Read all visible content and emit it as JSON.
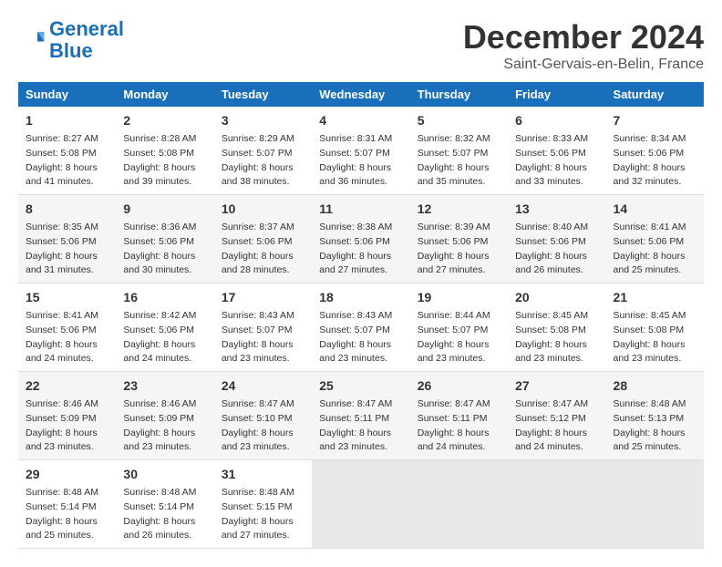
{
  "logo": {
    "line1": "General",
    "line2": "Blue"
  },
  "title": "December 2024",
  "location": "Saint-Gervais-en-Belin, France",
  "days_header": [
    "Sunday",
    "Monday",
    "Tuesday",
    "Wednesday",
    "Thursday",
    "Friday",
    "Saturday"
  ],
  "weeks": [
    [
      {
        "day": "1",
        "rise": "8:27 AM",
        "set": "5:08 PM",
        "daylight": "8 hours and 41 minutes."
      },
      {
        "day": "2",
        "rise": "8:28 AM",
        "set": "5:08 PM",
        "daylight": "8 hours and 39 minutes."
      },
      {
        "day": "3",
        "rise": "8:29 AM",
        "set": "5:07 PM",
        "daylight": "8 hours and 38 minutes."
      },
      {
        "day": "4",
        "rise": "8:31 AM",
        "set": "5:07 PM",
        "daylight": "8 hours and 36 minutes."
      },
      {
        "day": "5",
        "rise": "8:32 AM",
        "set": "5:07 PM",
        "daylight": "8 hours and 35 minutes."
      },
      {
        "day": "6",
        "rise": "8:33 AM",
        "set": "5:06 PM",
        "daylight": "8 hours and 33 minutes."
      },
      {
        "day": "7",
        "rise": "8:34 AM",
        "set": "5:06 PM",
        "daylight": "8 hours and 32 minutes."
      }
    ],
    [
      {
        "day": "8",
        "rise": "8:35 AM",
        "set": "5:06 PM",
        "daylight": "8 hours and 31 minutes."
      },
      {
        "day": "9",
        "rise": "8:36 AM",
        "set": "5:06 PM",
        "daylight": "8 hours and 30 minutes."
      },
      {
        "day": "10",
        "rise": "8:37 AM",
        "set": "5:06 PM",
        "daylight": "8 hours and 28 minutes."
      },
      {
        "day": "11",
        "rise": "8:38 AM",
        "set": "5:06 PM",
        "daylight": "8 hours and 27 minutes."
      },
      {
        "day": "12",
        "rise": "8:39 AM",
        "set": "5:06 PM",
        "daylight": "8 hours and 27 minutes."
      },
      {
        "day": "13",
        "rise": "8:40 AM",
        "set": "5:06 PM",
        "daylight": "8 hours and 26 minutes."
      },
      {
        "day": "14",
        "rise": "8:41 AM",
        "set": "5:06 PM",
        "daylight": "8 hours and 25 minutes."
      }
    ],
    [
      {
        "day": "15",
        "rise": "8:41 AM",
        "set": "5:06 PM",
        "daylight": "8 hours and 24 minutes."
      },
      {
        "day": "16",
        "rise": "8:42 AM",
        "set": "5:06 PM",
        "daylight": "8 hours and 24 minutes."
      },
      {
        "day": "17",
        "rise": "8:43 AM",
        "set": "5:07 PM",
        "daylight": "8 hours and 23 minutes."
      },
      {
        "day": "18",
        "rise": "8:43 AM",
        "set": "5:07 PM",
        "daylight": "8 hours and 23 minutes."
      },
      {
        "day": "19",
        "rise": "8:44 AM",
        "set": "5:07 PM",
        "daylight": "8 hours and 23 minutes."
      },
      {
        "day": "20",
        "rise": "8:45 AM",
        "set": "5:08 PM",
        "daylight": "8 hours and 23 minutes."
      },
      {
        "day": "21",
        "rise": "8:45 AM",
        "set": "5:08 PM",
        "daylight": "8 hours and 23 minutes."
      }
    ],
    [
      {
        "day": "22",
        "rise": "8:46 AM",
        "set": "5:09 PM",
        "daylight": "8 hours and 23 minutes."
      },
      {
        "day": "23",
        "rise": "8:46 AM",
        "set": "5:09 PM",
        "daylight": "8 hours and 23 minutes."
      },
      {
        "day": "24",
        "rise": "8:47 AM",
        "set": "5:10 PM",
        "daylight": "8 hours and 23 minutes."
      },
      {
        "day": "25",
        "rise": "8:47 AM",
        "set": "5:11 PM",
        "daylight": "8 hours and 23 minutes."
      },
      {
        "day": "26",
        "rise": "8:47 AM",
        "set": "5:11 PM",
        "daylight": "8 hours and 24 minutes."
      },
      {
        "day": "27",
        "rise": "8:47 AM",
        "set": "5:12 PM",
        "daylight": "8 hours and 24 minutes."
      },
      {
        "day": "28",
        "rise": "8:48 AM",
        "set": "5:13 PM",
        "daylight": "8 hours and 25 minutes."
      }
    ],
    [
      {
        "day": "29",
        "rise": "8:48 AM",
        "set": "5:14 PM",
        "daylight": "8 hours and 25 minutes."
      },
      {
        "day": "30",
        "rise": "8:48 AM",
        "set": "5:14 PM",
        "daylight": "8 hours and 26 minutes."
      },
      {
        "day": "31",
        "rise": "8:48 AM",
        "set": "5:15 PM",
        "daylight": "8 hours and 27 minutes."
      },
      null,
      null,
      null,
      null
    ]
  ],
  "labels": {
    "sunrise": "Sunrise:",
    "sunset": "Sunset:",
    "daylight": "Daylight:"
  }
}
